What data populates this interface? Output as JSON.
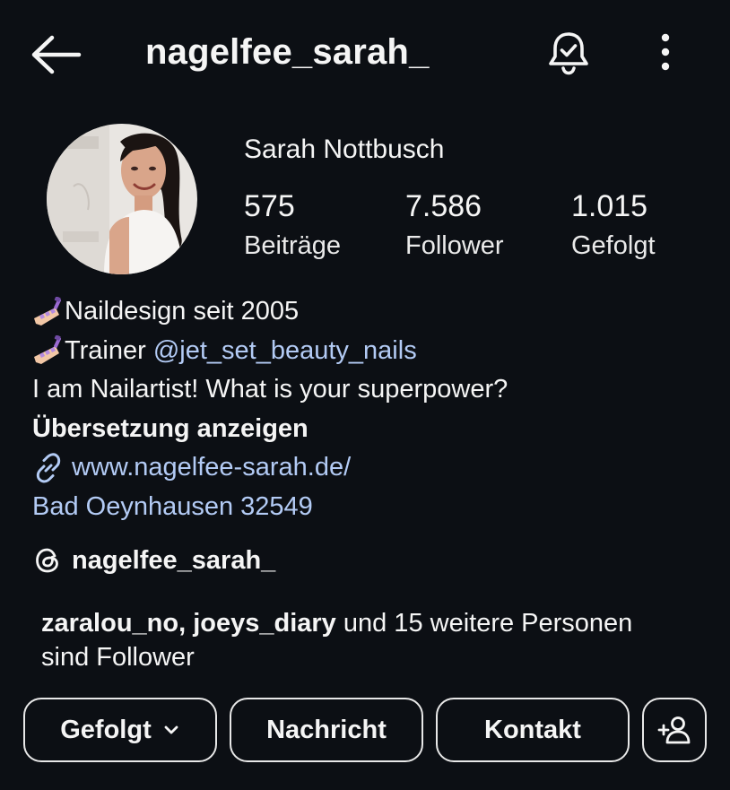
{
  "header": {
    "username": "nagelfee_sarah_",
    "back_icon": "arrow-left-icon",
    "bell_icon": "bell-check-icon",
    "more_icon": "more-vertical-icon"
  },
  "profile": {
    "full_name": "Sarah Nottbusch",
    "stats": [
      {
        "value": "575",
        "label": "Beiträge"
      },
      {
        "value": "7.586",
        "label": "Follower"
      },
      {
        "value": "1.015",
        "label": "Gefolgt"
      }
    ]
  },
  "bio": {
    "line1": "Naildesign seit 2005",
    "line2_prefix": "Trainer ",
    "line2_mention": "@jet_set_beauty_nails",
    "line3": "I am Nailartist! What is your superpower?",
    "translate": "Übersetzung anzeigen",
    "website": "www.nagelfee-sarah.de/",
    "location": "Bad Oeynhausen 32549"
  },
  "threads": {
    "handle": "nagelfee_sarah_"
  },
  "followed_by": {
    "names": "zaralou_no, joeys_diary",
    "rest_line1": " und 15 weitere Personen",
    "rest_line2": "sind Follower"
  },
  "buttons": {
    "following": "Gefolgt",
    "message": "Nachricht",
    "contact": "Kontakt",
    "add_person_icon": "add-person-icon"
  },
  "colors": {
    "background": "#0c0f14",
    "link": "#b3cbf5",
    "text": "#f5f5f5"
  }
}
